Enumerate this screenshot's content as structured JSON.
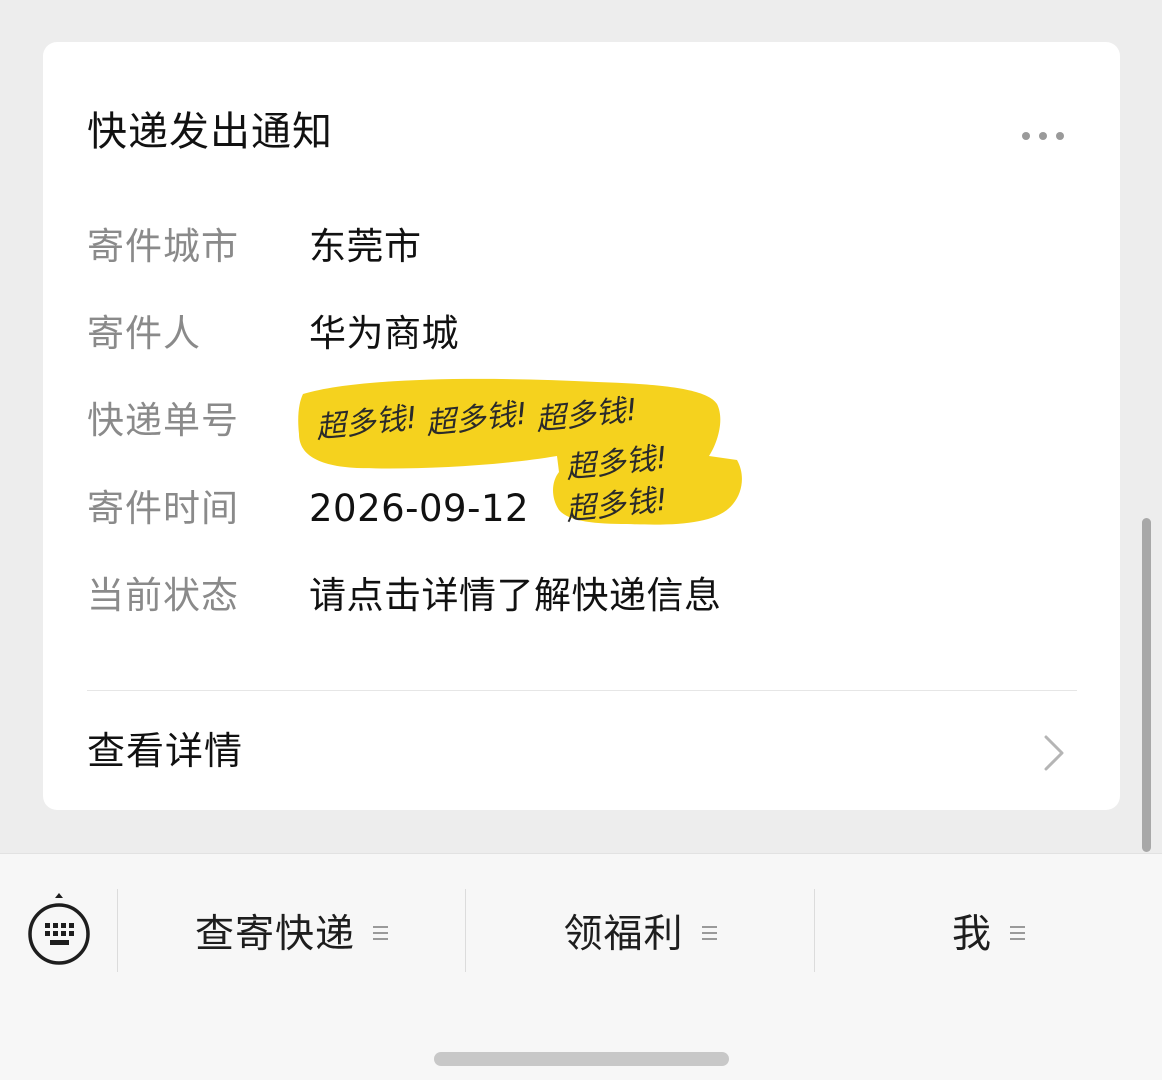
{
  "card": {
    "title": "快递发出通知",
    "rows": [
      {
        "label": "寄件城市",
        "value": "东莞市"
      },
      {
        "label": "寄件人",
        "value": "华为商城"
      },
      {
        "label": "快递单号",
        "value": ""
      },
      {
        "label": "寄件时间",
        "value": "2026-09-12"
      },
      {
        "label": "当前状态",
        "value": "请点击详情了解快递信息"
      }
    ],
    "detail_label": "查看详情",
    "redaction_text": "超多钱!"
  },
  "menu": {
    "items": [
      {
        "label": "查寄快递"
      },
      {
        "label": "领福利"
      },
      {
        "label": "我"
      }
    ]
  },
  "icons": {
    "more": "more-dots-icon",
    "chevron": "chevron-right-icon",
    "keyboard": "keyboard-icon"
  },
  "colors": {
    "redaction_yellow": "#f5d21e",
    "background": "#ededed",
    "card": "#ffffff"
  }
}
